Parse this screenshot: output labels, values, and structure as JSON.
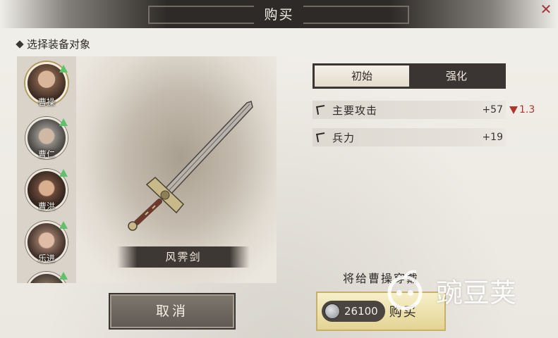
{
  "dialog": {
    "title": "购买",
    "close_symbol": "✕"
  },
  "select_section": {
    "label": "选择装备对象"
  },
  "characters": [
    {
      "name": "曹操",
      "selected": true,
      "indicator": "upgrade-arrow",
      "face_color": "#7a5a46"
    },
    {
      "name": "曹仁",
      "selected": false,
      "indicator": "upgrade-arrow",
      "face_color": "#6e6a64"
    },
    {
      "name": "曹洪",
      "selected": false,
      "indicator": "upgrade-arrow",
      "face_color": "#6b4a3b"
    },
    {
      "name": "乐进",
      "selected": false,
      "indicator": "upgrade-arrow",
      "face_color": "#8b6d5e"
    },
    {
      "name": "",
      "selected": false,
      "indicator": "upgrade-arrow",
      "face_color": "#7b6a5a"
    }
  ],
  "weapon": {
    "name": "风霁剑"
  },
  "tabs": [
    {
      "label": "初始",
      "active": true
    },
    {
      "label": "强化",
      "active": false
    }
  ],
  "stats": [
    {
      "label": "主要攻击",
      "value": "+57",
      "delta": "1.3"
    },
    {
      "label": "兵力",
      "value": "+19",
      "delta": ""
    }
  ],
  "equip_target_text": "将给曹操穿戴",
  "actions": {
    "cancel_label": "取消",
    "buy_price": "26100",
    "buy_label": "购买"
  },
  "watermark": {
    "text": "豌豆荚"
  },
  "colors": {
    "title_bar": "#2e2a27",
    "upgrade_arrow": "#5ec26c",
    "negative_delta": "#b3342f",
    "buy_button": "#e4d494"
  }
}
